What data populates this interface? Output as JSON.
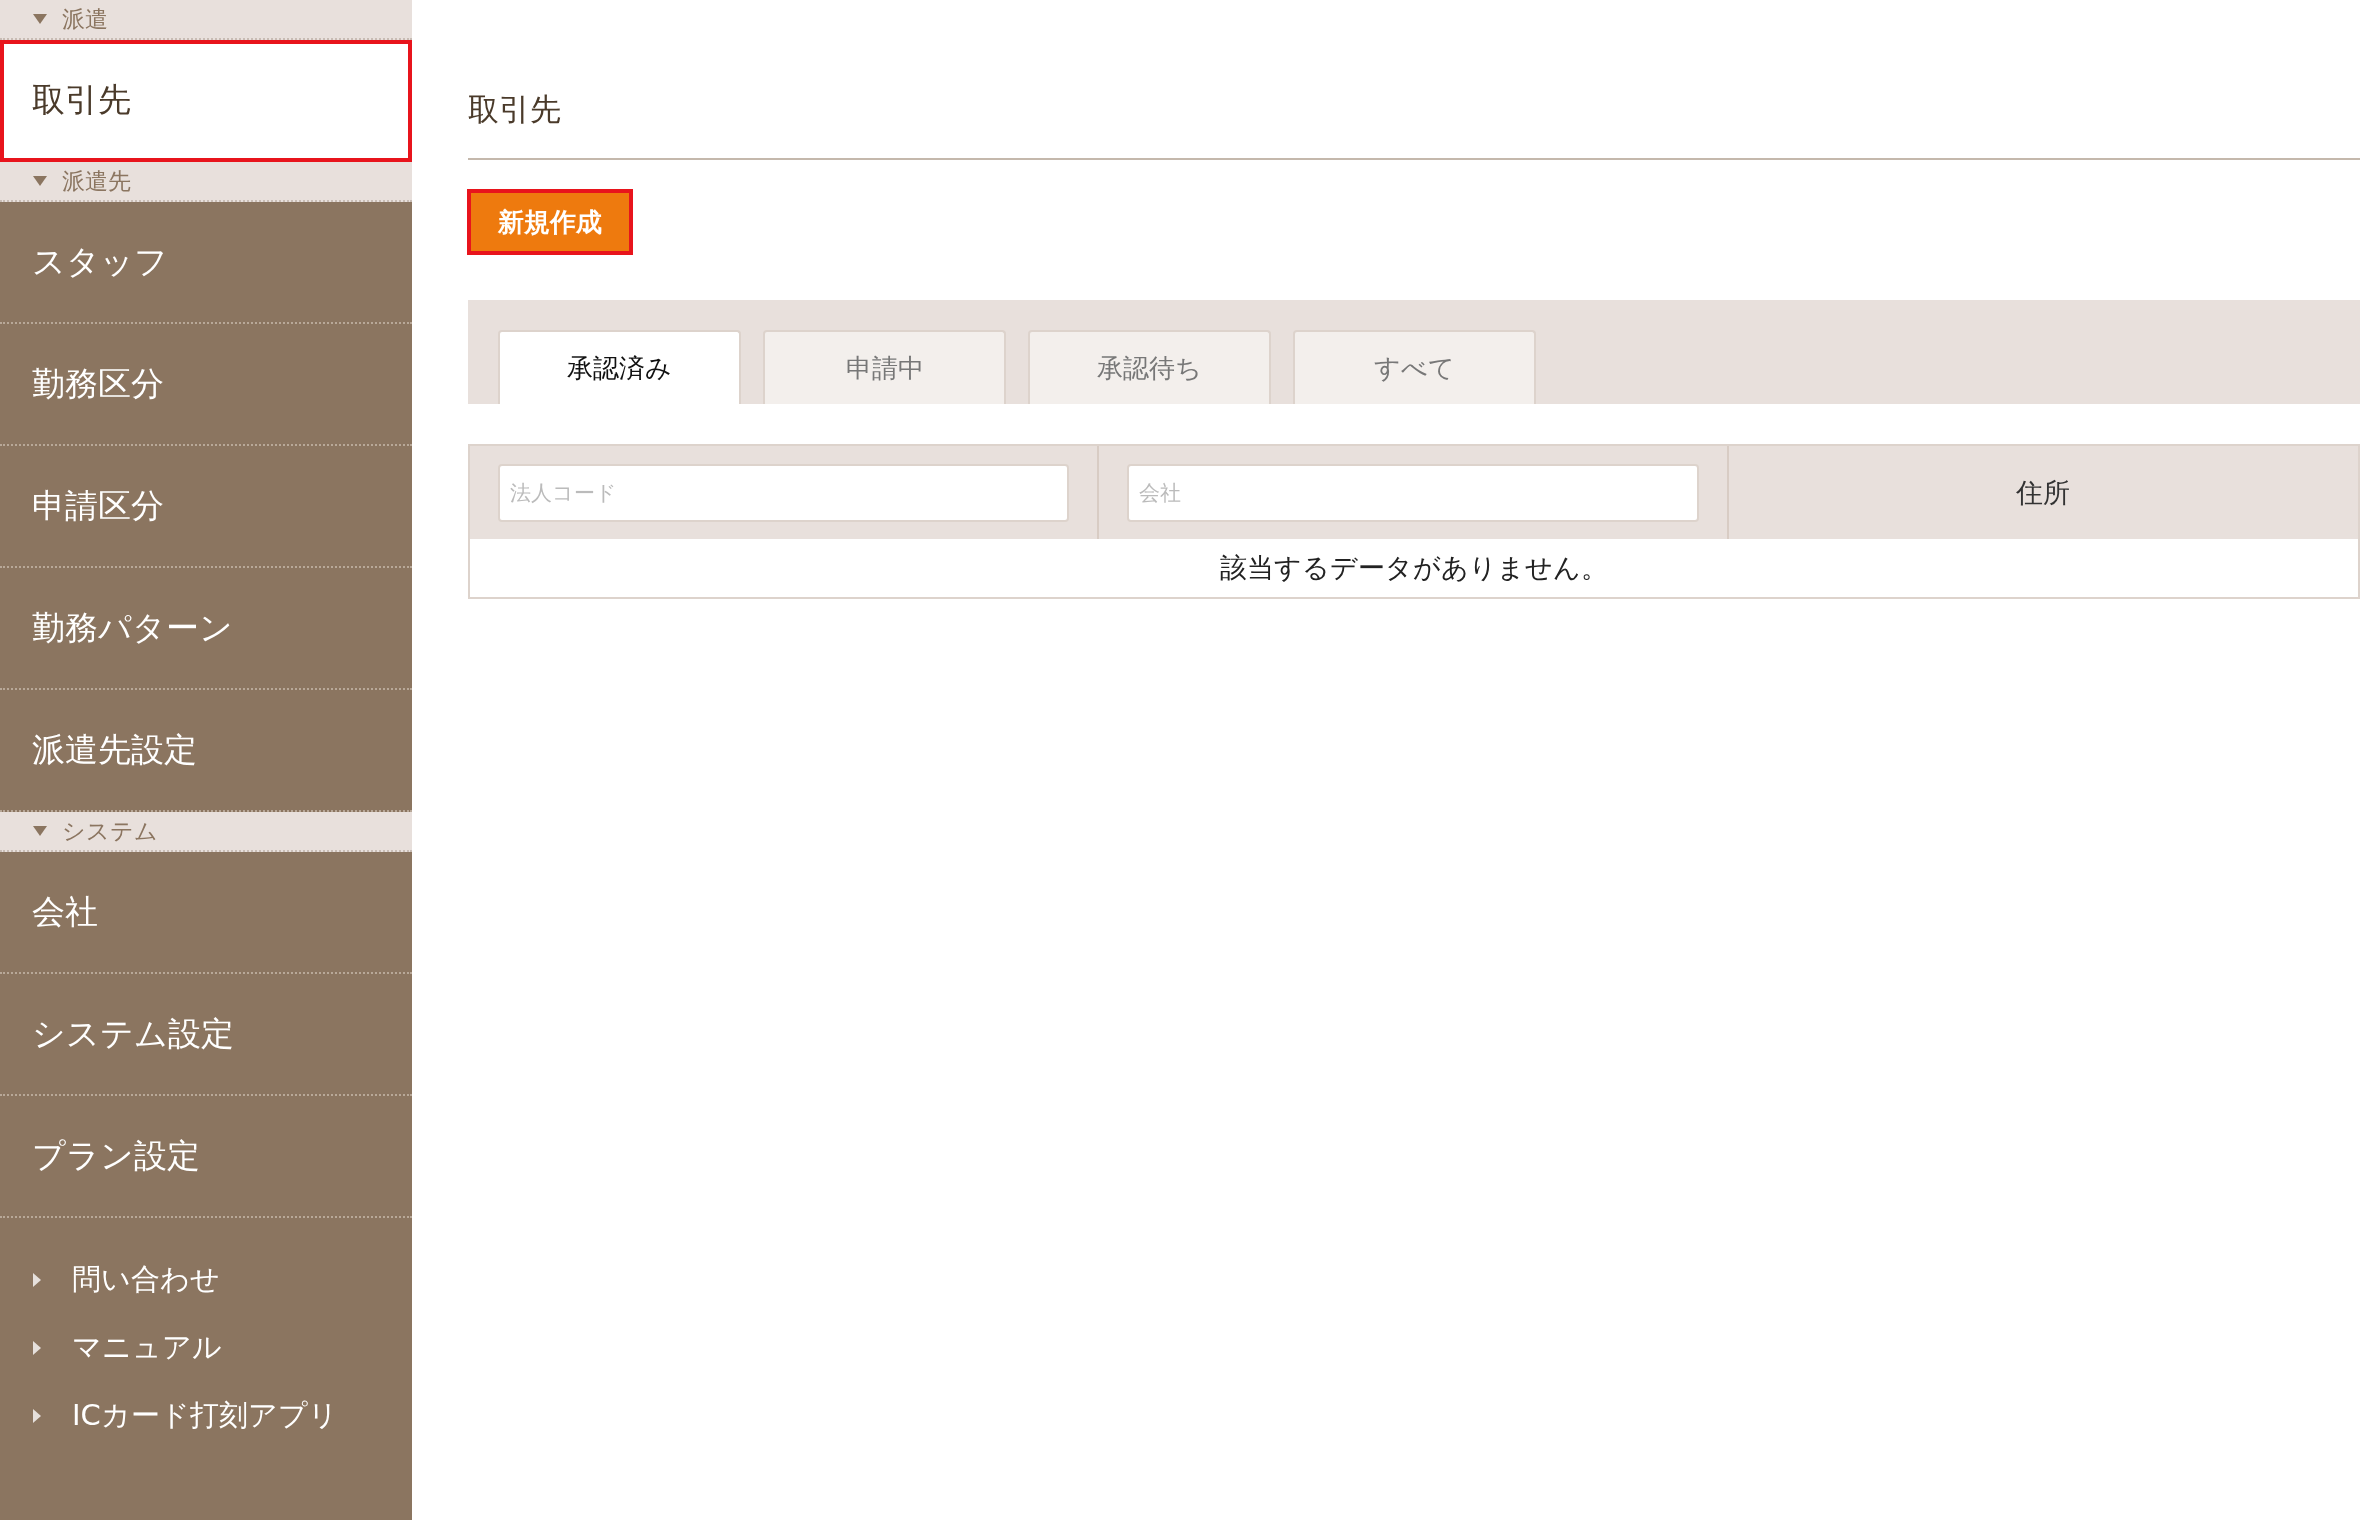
{
  "sidebar": {
    "sections": [
      {
        "title": "派遣",
        "expanded": true,
        "items": [
          {
            "label": "取引先",
            "selected": true,
            "highlighted": true
          }
        ]
      },
      {
        "title": "派遣先",
        "expanded": true,
        "items": [
          {
            "label": "スタッフ",
            "selected": false,
            "highlighted": false
          },
          {
            "label": "勤務区分",
            "selected": false,
            "highlighted": false
          },
          {
            "label": "申請区分",
            "selected": false,
            "highlighted": false
          },
          {
            "label": "勤務パターン",
            "selected": false,
            "highlighted": false
          },
          {
            "label": "派遣先設定",
            "selected": false,
            "highlighted": false
          }
        ]
      },
      {
        "title": "システム",
        "expanded": true,
        "items": [
          {
            "label": "会社",
            "selected": false,
            "highlighted": false
          },
          {
            "label": "システム設定",
            "selected": false,
            "highlighted": false
          },
          {
            "label": "プラン設定",
            "selected": false,
            "highlighted": false
          }
        ]
      }
    ],
    "links": [
      "問い合わせ",
      "マニュアル",
      "ICカード打刻アプリ"
    ]
  },
  "page": {
    "title": "取引先",
    "new_button": {
      "label": "新規作成",
      "highlighted": true
    }
  },
  "tabs": [
    {
      "label": "承認済み",
      "selected": true
    },
    {
      "label": "申請中",
      "selected": false
    },
    {
      "label": "承認待ち",
      "selected": false
    },
    {
      "label": "すべて",
      "selected": false
    }
  ],
  "table": {
    "columns": [
      {
        "kind": "filter",
        "placeholder": "法人コード"
      },
      {
        "kind": "filter",
        "placeholder": "会社"
      },
      {
        "kind": "label",
        "label": "住所"
      }
    ],
    "empty_message": "該当するデータがありません。"
  }
}
